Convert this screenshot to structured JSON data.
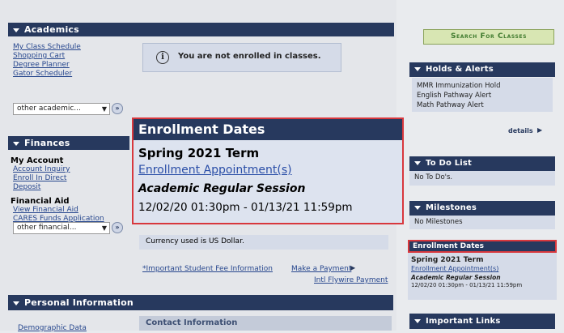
{
  "academics": {
    "header": "Academics",
    "links": [
      "My Class Schedule",
      "Shopping Cart",
      "Degree Planner",
      "Gator Scheduler"
    ],
    "select_value": "other academic...",
    "notice": "You are not enrolled in classes."
  },
  "finances": {
    "header": "Finances",
    "my_account_label": "My Account",
    "account_links": [
      "Account Inquiry",
      "Enroll In Direct",
      "Deposit"
    ],
    "financial_aid_label": "Financial Aid",
    "aid_links": [
      "View Financial Aid",
      "CARES Funds Application"
    ],
    "select_value": "other financial...",
    "currency_note": "Currency used is US Dollar.",
    "fee_info_link": "*Important Student Fee Information",
    "make_payment_link": "Make a Payment",
    "flywire_link": "Intl Flywire Payment"
  },
  "personal": {
    "header": "Personal Information",
    "demographic_link": "Demographic Data",
    "contact_header": "Contact Information"
  },
  "search_button": "Search For Classes",
  "holds": {
    "header": "Holds & Alerts",
    "items": [
      "MMR Immunization Hold",
      "English Pathway Alert",
      "Math Pathway Alert"
    ],
    "details_link": "details"
  },
  "todo": {
    "header": "To Do List",
    "text": "No To Do's."
  },
  "milestones": {
    "header": "Milestones",
    "text": "No Milestones"
  },
  "enrollment_small": {
    "header": "Enrollment Dates",
    "term": "Spring 2021 Term",
    "appointment_link": "Enrollment Appointment(s)",
    "session": "Academic Regular Session",
    "dates": "12/02/20 01:30pm - 01/13/21 11:59pm"
  },
  "enrollment_zoom": {
    "header": "Enrollment Dates",
    "term": "Spring 2021 Term",
    "appointment_link": "Enrollment Appointment(s)",
    "session": "Academic Regular Session",
    "dates": "12/02/20 01:30pm - 01/13/21 11:59pm"
  },
  "important_links": {
    "header": "Important Links"
  },
  "colors": {
    "header_bg": "#27395e",
    "highlight_border": "#d8383d",
    "accent_green": "#3f7a2e"
  }
}
